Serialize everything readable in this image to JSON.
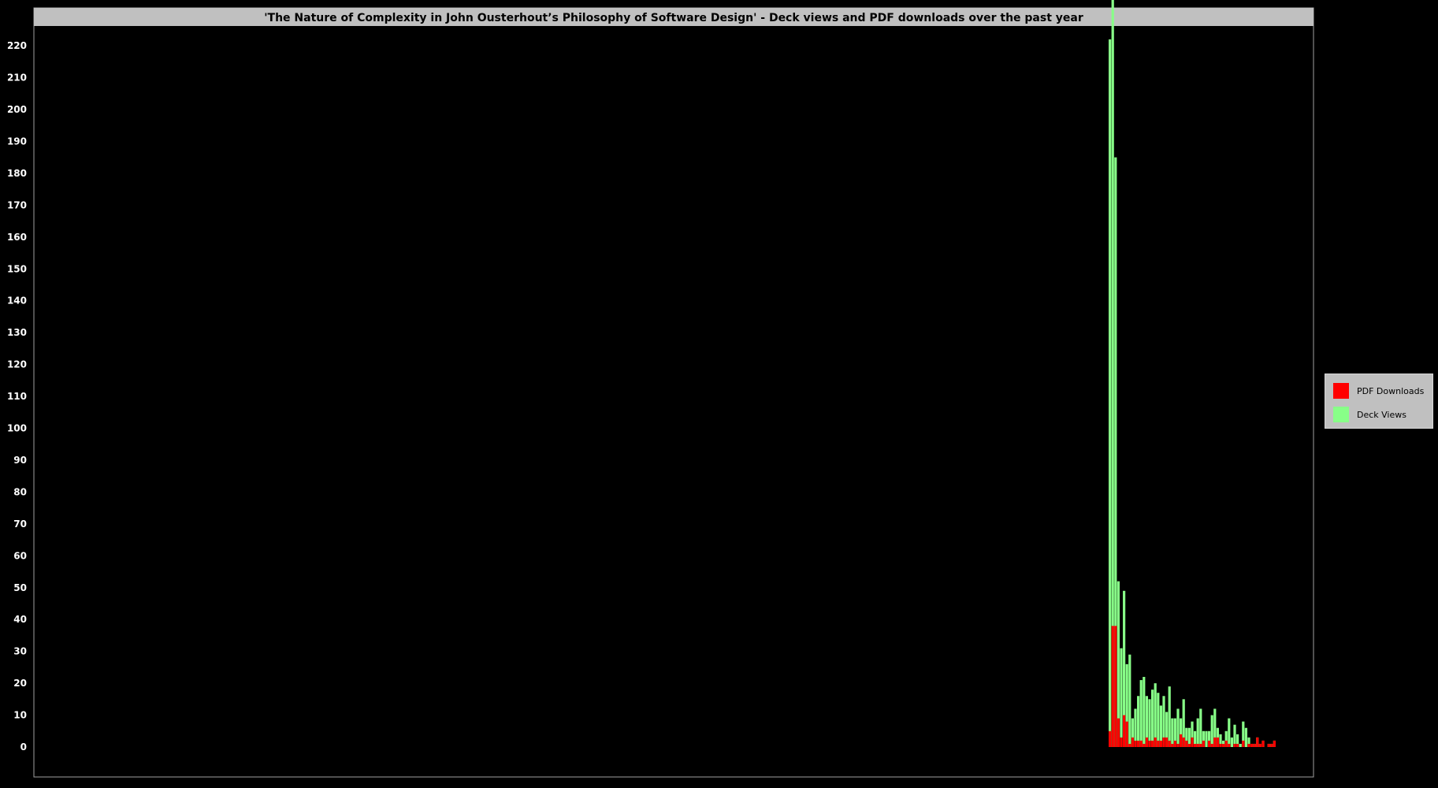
{
  "chart_data": {
    "type": "bar",
    "stacked": true,
    "title": "'The Nature of Complexity in John Ousterhout’s Philosophy of Software Design' - Deck views and PDF downloads over the past year",
    "xlabel": "",
    "ylabel": "",
    "ylim": [
      0,
      225
    ],
    "yticks": [
      0,
      10,
      20,
      30,
      40,
      50,
      60,
      70,
      80,
      90,
      100,
      110,
      120,
      130,
      140,
      150,
      160,
      170,
      180,
      190,
      200,
      210,
      220
    ],
    "xlim_days": [
      0,
      365
    ],
    "grid": false,
    "legend_position": "right",
    "series": [
      {
        "name": "PDF Downloads",
        "color": "#ff0000",
        "values": [
          5,
          38,
          38,
          9,
          3,
          10,
          8,
          1,
          3,
          2,
          2,
          2,
          1,
          3,
          2,
          2,
          3,
          2,
          2,
          3,
          3,
          2,
          1,
          2,
          1,
          4,
          3,
          2,
          1,
          3,
          1,
          1,
          1,
          2,
          0,
          2,
          1,
          3,
          3,
          1,
          1,
          2,
          1,
          0,
          1,
          1,
          0,
          2,
          0,
          1,
          1,
          1,
          3,
          1,
          2,
          0,
          1,
          1,
          2
        ]
      },
      {
        "name": "Deck Views",
        "color": "#88ff88",
        "values": [
          217,
          209,
          147,
          43,
          28,
          39,
          18,
          28,
          6,
          10,
          14,
          19,
          21,
          13,
          13,
          16,
          17,
          15,
          11,
          13,
          8,
          17,
          8,
          7,
          11,
          5,
          12,
          4,
          5,
          5,
          4,
          8,
          11,
          3,
          5,
          3,
          9,
          9,
          3,
          3,
          1,
          3,
          8,
          3,
          6,
          3,
          1,
          6,
          6,
          2,
          0,
          0,
          0,
          0,
          0,
          0,
          0,
          0,
          0
        ]
      }
    ]
  },
  "legend": {
    "items": [
      {
        "label": "PDF Downloads",
        "color": "#ff0000"
      },
      {
        "label": "Deck Views",
        "color": "#88ff88"
      }
    ]
  }
}
